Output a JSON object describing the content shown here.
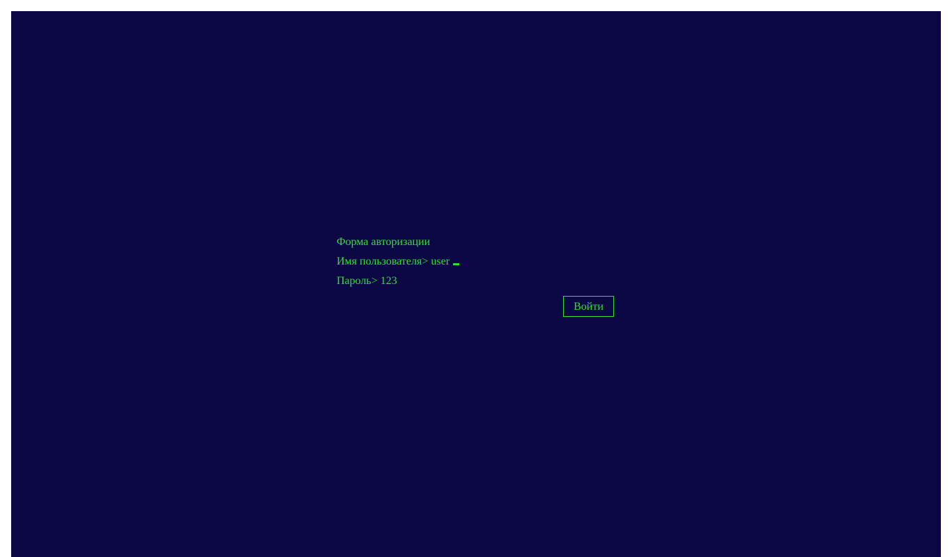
{
  "form": {
    "title": "Форма авторизации",
    "username_label": "Имя пользователя>",
    "username_value": "user",
    "password_label": "Пароль>",
    "password_value": "123",
    "submit_label": "Войти"
  },
  "colors": {
    "background": "#0a0744",
    "text": "#2fe02f",
    "page": "#ffffff"
  }
}
